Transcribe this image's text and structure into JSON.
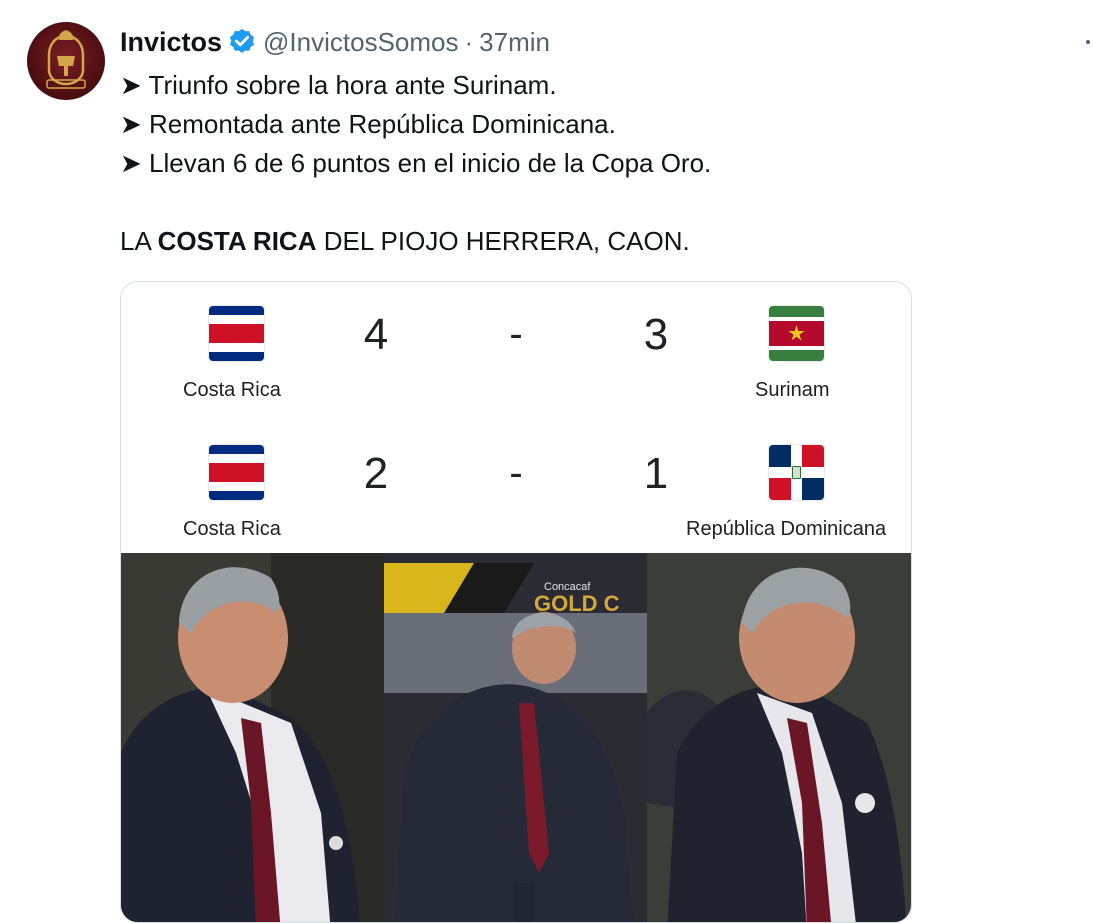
{
  "tweet": {
    "author_name": "Invictos",
    "handle": "@InvictosSomos",
    "separator": "·",
    "time": "37min",
    "lines": [
      "➤ Triunfo sobre la hora ante Surinam.",
      "➤ Remontada ante República Dominicana.",
      "➤ Llevan 6 de 6 puntos en el inicio de la Copa Oro."
    ],
    "closing_prefix": "LA ",
    "closing_bold": "COSTA RICA",
    "closing_suffix": " DEL PIOJO HERRERA, CAON."
  },
  "matches": [
    {
      "home_team": "Costa Rica",
      "home_score": "4",
      "away_score": "3",
      "away_team": "Surinam",
      "separator": "-",
      "home_flag": "costa-rica-flag",
      "away_flag": "suriname-flag"
    },
    {
      "home_team": "Costa Rica",
      "home_score": "2",
      "away_score": "1",
      "away_team": "República Dominicana",
      "separator": "-",
      "home_flag": "costa-rica-flag",
      "away_flag": "dominican-republic-flag"
    }
  ],
  "photos": {
    "banner_small": "Concacaf",
    "banner_large": "GOLD C"
  },
  "colors": {
    "verified": "#1d9bf0",
    "avatar_bg": "#5a1216",
    "text": "#0f1419",
    "muted": "#536471"
  }
}
